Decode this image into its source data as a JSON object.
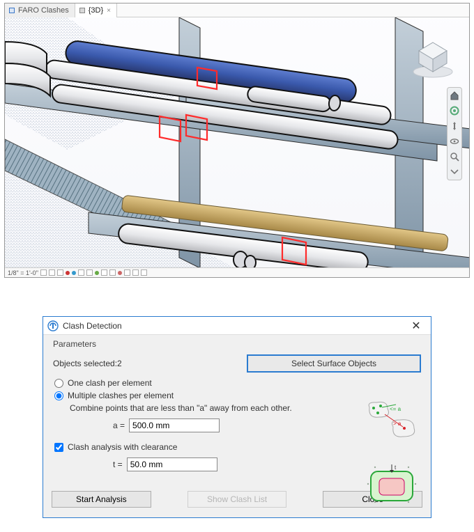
{
  "tabs": {
    "inactive": {
      "label": "FARO Clashes",
      "icon_color": "#3a76c8"
    },
    "active": {
      "label": "{3D}",
      "icon_color": "#555"
    },
    "close_glyph": "×"
  },
  "status": {
    "scale": "1/8\" = 1'-0\""
  },
  "nav_tools": [
    "home-icon",
    "wheel-icon",
    "pan-icon",
    "orbit-icon",
    "zoom-icon",
    "chevron-icon"
  ],
  "dialog": {
    "title": "Clash Detection",
    "close": "✕",
    "section_label": "Parameters",
    "objects_label_prefix": "Objects selected:",
    "objects_count": "2",
    "select_surface_btn": "Select Surface Objects",
    "radio": {
      "one": {
        "label": "One clash per element",
        "checked": false
      },
      "many": {
        "label": "Multiple clashes per element",
        "checked": true
      }
    },
    "combine_hint": "Combine points that are less than \"a\" away from each other.",
    "a_label": "a  =",
    "a_value": "500.0 mm",
    "clearance": {
      "label": "Clash analysis with clearance",
      "checked": true
    },
    "t_label": "t  =",
    "t_value": "50.0 mm",
    "buttons": {
      "start": "Start Analysis",
      "show": "Show Clash List",
      "close": "Close"
    }
  },
  "colors": {
    "accent": "#2a7bd0",
    "steel": "#8fa4b5",
    "steel_dark": "#5c7386",
    "pipe": "#f2f2f4",
    "pipe_blue": "#3b5fb0",
    "beam_tan": "#c8a763",
    "clash": "#ff2b2b",
    "green_ok": "#2aa83a",
    "red_warn": "#d8232a"
  }
}
